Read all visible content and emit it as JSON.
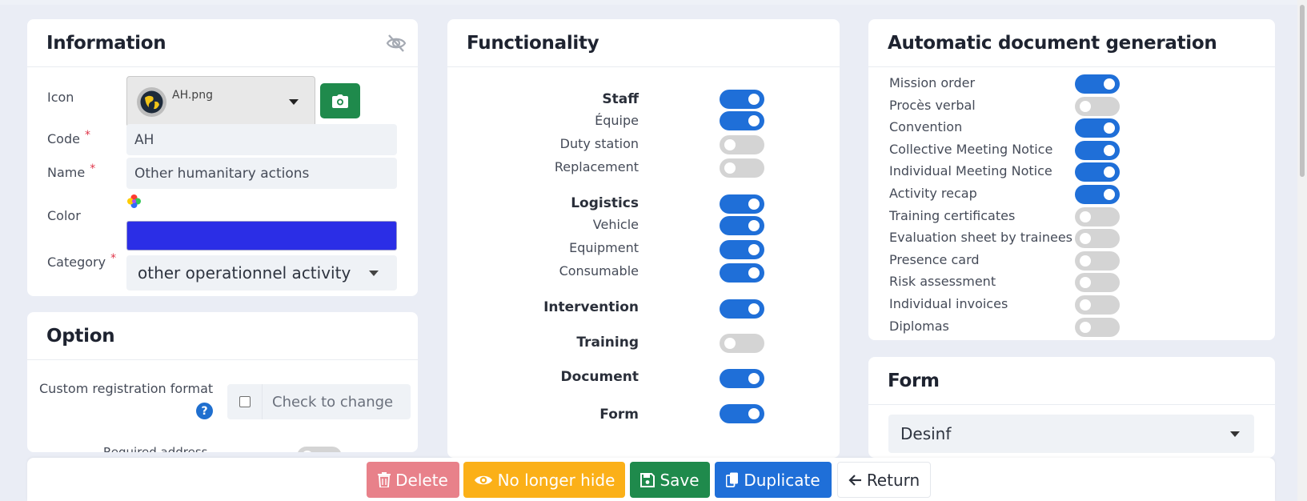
{
  "information": {
    "title": "Information",
    "icon_label": "Icon",
    "icon_file": "AH.png",
    "code_label": "Code",
    "code_value": "AH",
    "name_label": "Name",
    "name_value": "Other humanitary actions",
    "color_label": "Color",
    "color_value": "#2b2ee6",
    "category_label": "Category",
    "category_value": "other operationnel activity",
    "required_mark": "*"
  },
  "option": {
    "title": "Option",
    "custom_format_label": "Custom registration format",
    "help_glyph": "?",
    "check_text": "Check to change",
    "required_address_label": "Required address"
  },
  "functionality": {
    "title": "Functionality",
    "items": [
      {
        "label": "Staff",
        "bold": true,
        "on": true
      },
      {
        "label": "Équipe",
        "bold": false,
        "on": true
      },
      {
        "label": "Duty station",
        "bold": false,
        "on": false
      },
      {
        "label": "Replacement",
        "bold": false,
        "on": false
      },
      {
        "label": "Logistics",
        "bold": true,
        "on": true
      },
      {
        "label": "Vehicle",
        "bold": false,
        "on": true
      },
      {
        "label": "Equipment",
        "bold": false,
        "on": true
      },
      {
        "label": "Consumable",
        "bold": false,
        "on": true
      },
      {
        "label": "Intervention",
        "bold": true,
        "on": true
      },
      {
        "label": "Training",
        "bold": true,
        "on": false
      },
      {
        "label": "Document",
        "bold": true,
        "on": true
      },
      {
        "label": "Form",
        "bold": true,
        "on": true
      }
    ]
  },
  "auto_docs": {
    "title": "Automatic document generation",
    "items": [
      {
        "label": "Mission order",
        "on": true
      },
      {
        "label": "Procès verbal",
        "on": false
      },
      {
        "label": "Convention",
        "on": true
      },
      {
        "label": "Collective Meeting Notice",
        "on": true
      },
      {
        "label": "Individual Meeting Notice",
        "on": true
      },
      {
        "label": "Activity recap",
        "on": true
      },
      {
        "label": "Training certificates",
        "on": false
      },
      {
        "label": "Evaluation sheet by trainees",
        "on": false
      },
      {
        "label": "Presence card",
        "on": false
      },
      {
        "label": "Risk assessment",
        "on": false
      },
      {
        "label": "Individual invoices",
        "on": false
      },
      {
        "label": "Diplomas",
        "on": false
      }
    ]
  },
  "form": {
    "title": "Form",
    "selected": "Desinf"
  },
  "actions": {
    "delete": "Delete",
    "unhide": "No longer hide",
    "save": "Save",
    "duplicate": "Duplicate",
    "return": "Return"
  },
  "colors": {
    "toggle_on": "#1f6fd8",
    "toggle_off": "#d4d4d4",
    "delete": "#e8818a",
    "unhide": "#fbb018",
    "save": "#1f8a4c",
    "duplicate": "#1f6fd8",
    "camera": "#1f8a4c"
  }
}
